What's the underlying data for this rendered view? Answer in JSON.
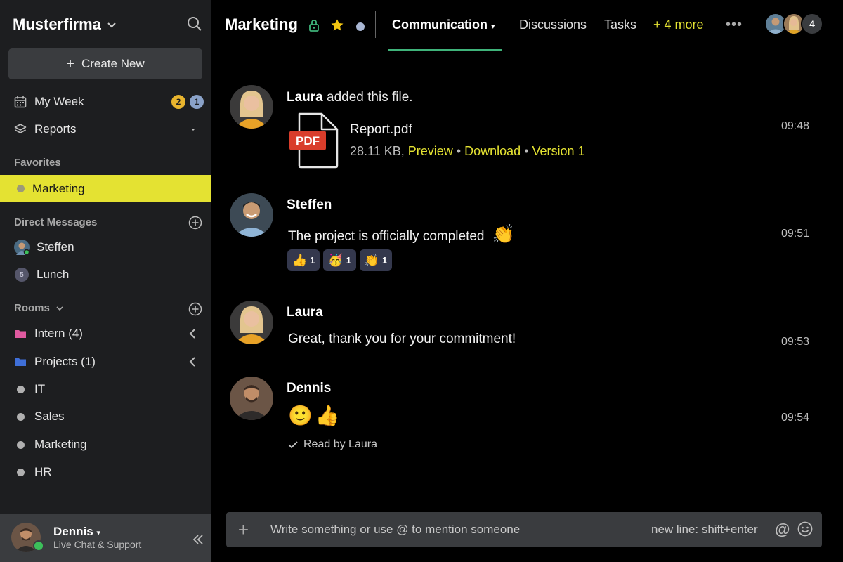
{
  "workspace": {
    "name": "Musterfirma"
  },
  "sidebar": {
    "create_label": "Create New",
    "my_week": {
      "label": "My Week",
      "badge_yellow": "2",
      "badge_blue": "1"
    },
    "reports": {
      "label": "Reports"
    },
    "favorites": {
      "title": "Favorites",
      "items": [
        {
          "label": "Marketing"
        }
      ]
    },
    "direct_messages": {
      "title": "Direct Messages",
      "items": [
        {
          "label": "Steffen"
        },
        {
          "label": "Lunch",
          "count": "5"
        }
      ]
    },
    "rooms": {
      "title": "Rooms",
      "items": [
        {
          "label": "Intern (4)"
        },
        {
          "label": "Projects (1)"
        },
        {
          "label": "IT"
        },
        {
          "label": "Sales"
        },
        {
          "label": "Marketing"
        },
        {
          "label": "HR"
        }
      ]
    },
    "user": {
      "name": "Dennis",
      "status": "Live Chat & Support"
    }
  },
  "header": {
    "title": "Marketing",
    "tabs": [
      {
        "label": "Communication"
      },
      {
        "label": "Discussions"
      },
      {
        "label": "Tasks"
      },
      {
        "label": "+ 4 more"
      }
    ],
    "member_count": "4"
  },
  "messages": [
    {
      "author": "Laura",
      "action": "added this file.",
      "time": "09:48",
      "file": {
        "type_label": "PDF",
        "name": "Report.pdf",
        "size": "28.11 KB,",
        "preview": "Preview",
        "download": "Download",
        "version": "Version 1"
      }
    },
    {
      "author": "Steffen",
      "text": "The project is officially completed",
      "time": "09:51",
      "reactions": [
        {
          "emoji": "👍",
          "count": "1"
        },
        {
          "emoji": "🥳",
          "count": "1"
        },
        {
          "emoji": "👏",
          "count": "1"
        }
      ]
    },
    {
      "author": "Laura",
      "text": "Great, thank you for your commitment!",
      "time": "09:53"
    },
    {
      "author": "Dennis",
      "emoji": "🙂👍",
      "time": "09:54",
      "read_receipt": "Read by Laura"
    }
  ],
  "composer": {
    "placeholder": "Write something or use @ to mention someone",
    "hint": "new line: shift+enter"
  },
  "colors": {
    "accent_yellow": "#e4e232",
    "tab_underline": "#3fb37a",
    "online": "#3cbf5a"
  }
}
